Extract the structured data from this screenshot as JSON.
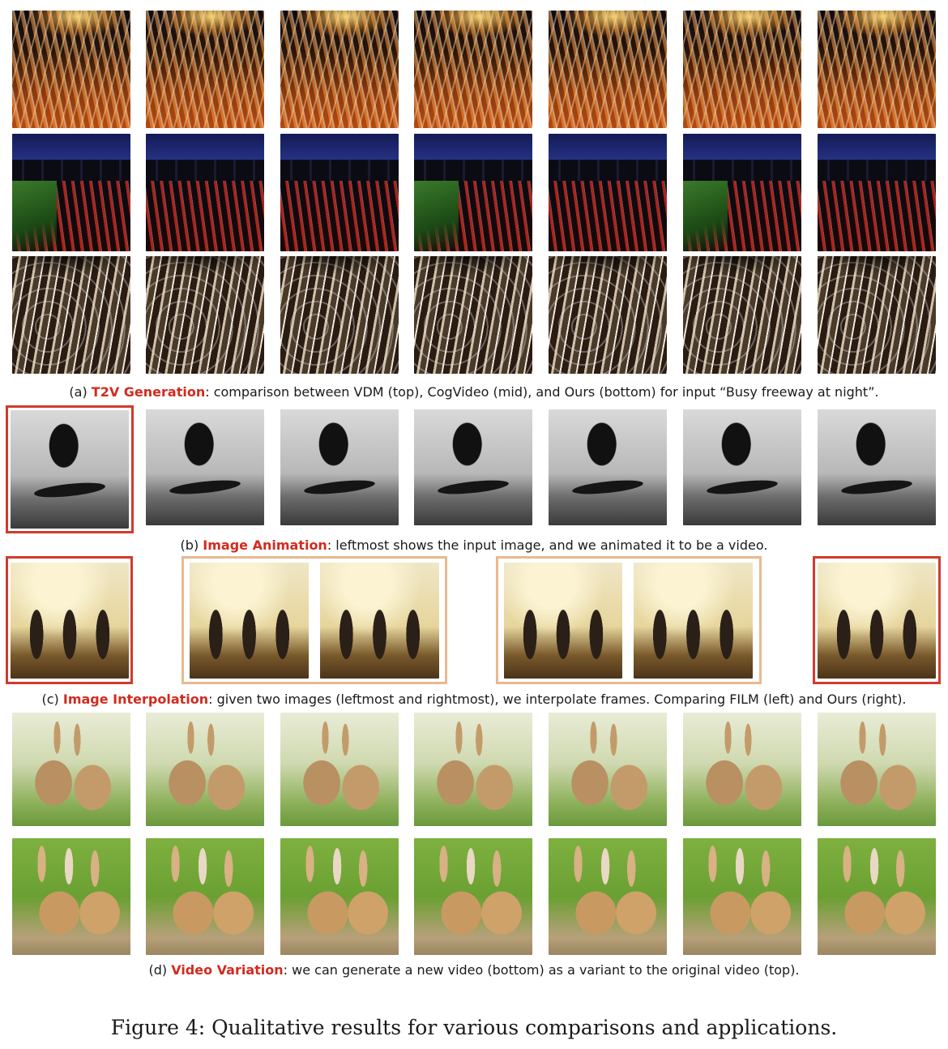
{
  "captions": {
    "a": {
      "prefix": "(a) ",
      "highlight": "T2V Generation",
      "rest": ": comparison between VDM (top), CogVideo (mid), and Ours (bottom) for input “Busy freeway at night”."
    },
    "b": {
      "prefix": "(b) ",
      "highlight": "Image Animation",
      "rest": ": leftmost shows the input image, and we animated it to be a video."
    },
    "c": {
      "prefix": "(c) ",
      "highlight": "Image Interpolation",
      "rest": ": given two images (leftmost and rightmost), we interpolate frames. Comparing FILM (left) and Ours (right)."
    },
    "d": {
      "prefix": "(d) ",
      "highlight": "Video Variation",
      "rest": ": we can generate a new video (bottom) as a variant to the original video (top)."
    }
  },
  "figure_title": "Figure 4: Qualitative results for various comparisons and applications.",
  "colors": {
    "highlight": "#d22b1e",
    "red_frame": "#d23a2c",
    "tan_frame": "#e9b98f"
  }
}
